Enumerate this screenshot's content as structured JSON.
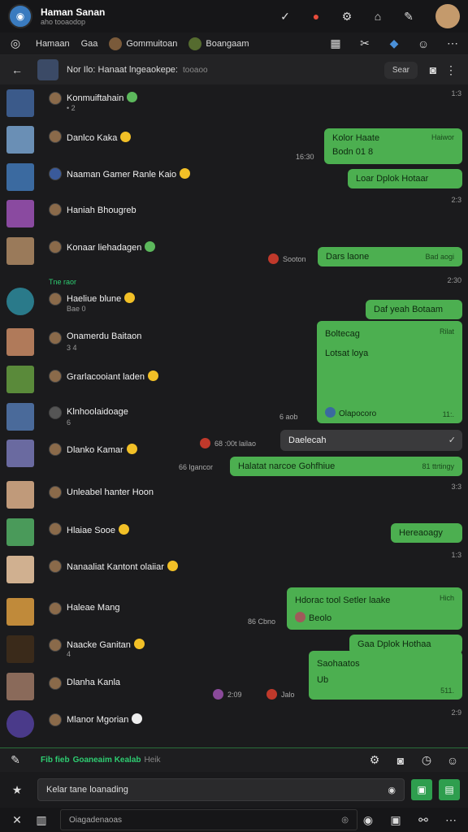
{
  "app": {
    "title": "Haman Sanan",
    "subtitle": "aho tooaodop"
  },
  "tabs": [
    {
      "label": "Hamaan"
    },
    {
      "label": "Gaa"
    },
    {
      "label": "Gommuitoan"
    },
    {
      "label": "Boangaam"
    }
  ],
  "header": {
    "title": "Nor Ilo: Hanaat lngeaokepe:",
    "sub": "tooaoo",
    "search": "Sear"
  },
  "rows": [
    {
      "name": "Konmuiftahain",
      "sub": "• 2"
    },
    {
      "name": "Danlco Kaka",
      "bubble1": "Kolor Haate",
      "bubble1b": "Bodn 01 8",
      "bubble1meta": "Haiwor",
      "side": "16:30"
    },
    {
      "name": "Naaman Gamer Ranle Kaio",
      "bubble": "Loar  Dplok  Hotaar",
      "time": "2:3"
    },
    {
      "name": "Haniah Bhougreb"
    },
    {
      "name": "Konaar liehadagen",
      "bubble": "Dars laone",
      "meta": "Bad aogi",
      "side": "Sooton"
    },
    {
      "label": "Tne raor",
      "name": "Haeliue blune",
      "sub": "Bae 0",
      "time": "2:30",
      "bubble": "Daf yeah  Botaam"
    },
    {
      "name": "Onamerdu Baitaon",
      "sub": "3 4",
      "big1": "Boltecag",
      "big2": "Lotsat loya",
      "bigmeta": "Rilat",
      "bigfoot": "Olapocoro",
      "bigtime": "11:.",
      "side": "6 aob"
    },
    {
      "name": "Grarlacooiant laden"
    },
    {
      "name": "Klnhoolaidoage",
      "sub": "6"
    },
    {
      "name": "Dlanko Kamar",
      "dark": "Daelecah",
      "side": "68 :00t lailao",
      "side2": "66 lgancor"
    },
    {
      "bubble": "Halatat narcoe Gohfhiue",
      "meta": "81 ttrtingy",
      "name": "Unleabel hanter Hoon",
      "time": "3:3"
    },
    {
      "name": "Hlaiae Sooe",
      "bubble": "Hereaoagy"
    },
    {
      "name": "Nanaaliat Kantont olaiiar",
      "time": "1:3"
    },
    {
      "name": "Haleae Mang",
      "bubble1": "Hdorac tool Setler laake",
      "bubble1b": "Beolo",
      "bubble1meta": "Hich",
      "side": "86 Cbno"
    },
    {
      "name": "Naacke Ganitan",
      "sub": "4",
      "bubble": "Gaa  Dplok  Hothaa"
    },
    {
      "name": "Dlanha Kanla",
      "bubble1": "Saohaatos",
      "bubble1b": "Ub",
      "bubble1meta": "511.",
      "side": "2:09",
      "side2": "Jalo"
    },
    {
      "name": "Mlanor Mgorian",
      "time": "2:9"
    }
  ],
  "status": {
    "left": "Fib fieb",
    "main": "Goaneaim Kealab",
    "right": "Heik"
  },
  "input": {
    "value": "Kelar tane loanading"
  },
  "bottom": {
    "value": "Oiagadenaoas"
  }
}
